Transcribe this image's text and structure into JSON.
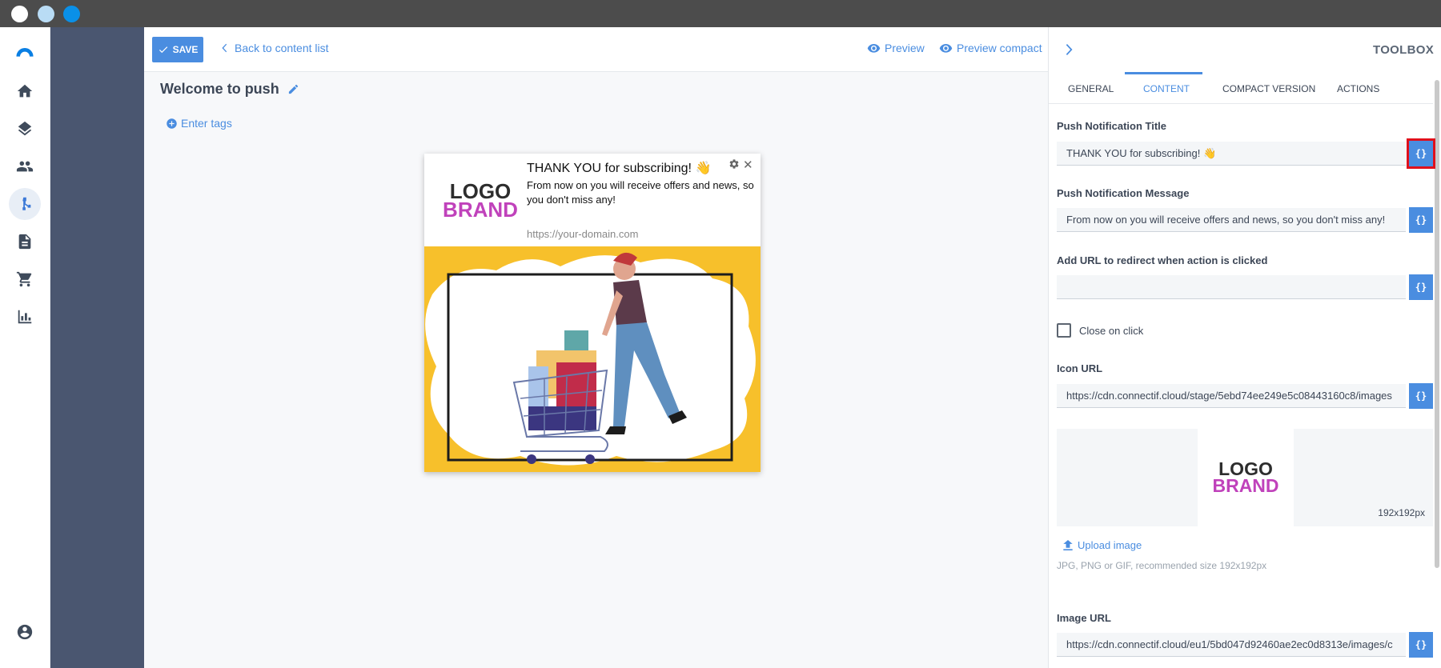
{
  "window": {
    "controls": [
      "close",
      "minimize",
      "maximize"
    ]
  },
  "nav": {
    "items": [
      {
        "icon": "logo-icon"
      },
      {
        "icon": "home-icon"
      },
      {
        "icon": "layers-icon"
      },
      {
        "icon": "people-icon"
      },
      {
        "icon": "workflow-icon",
        "active": true
      },
      {
        "icon": "document-icon"
      },
      {
        "icon": "cart-icon"
      },
      {
        "icon": "bar-chart-icon"
      },
      {
        "icon": "account-icon"
      }
    ]
  },
  "toolbar": {
    "save_label": "SAVE",
    "back_label": "Back to content list",
    "preview_label": "Preview",
    "preview_compact_label": "Preview compact"
  },
  "content": {
    "title": "Welcome to push",
    "tags_label": "Enter tags"
  },
  "push_preview": {
    "logo_line1": "LOGO",
    "logo_line2": "BRAND",
    "title": "THANK YOU for subscribing! 👋",
    "message": "From now on you will receive offers and news, so you don't miss any!",
    "domain": "https://your-domain.com",
    "close_glyph": "✕"
  },
  "toolbox": {
    "title": "TOOLBOX",
    "tabs": [
      "GENERAL",
      "CONTENT",
      "COMPACT VERSION",
      "ACTIONS"
    ],
    "active_tab": "CONTENT",
    "var_button_label": "{}",
    "fields": {
      "push_title": {
        "label": "Push Notification Title",
        "value": "THANK YOU for subscribing! 👋"
      },
      "push_message": {
        "label": "Push Notification Message",
        "value": "From now on you will receive offers and news, so you don't miss any!"
      },
      "redirect_url": {
        "label": "Add URL to redirect when action is clicked",
        "value": ""
      },
      "close_on_click": {
        "label": "Close on click",
        "checked": false
      },
      "icon_url": {
        "label": "Icon URL",
        "value": "https://cdn.connectif.cloud/stage/5ebd74ee249e5c08443160c8/images"
      },
      "image_url": {
        "label": "Image URL",
        "value": "https://cdn.connectif.cloud/eu1/5bd047d92460ae2ec0d8313e/images/c"
      }
    },
    "icon_preview": {
      "logo_line1": "LOGO",
      "logo_line2": "BRAND",
      "size_label": "192x192px"
    },
    "upload_label": "Upload image",
    "upload_hint": "JPG, PNG or GIF, recommended size 192x192px"
  },
  "colors": {
    "accent": "#4a8de0",
    "rail": "#4a5670",
    "titlebar": "#4c4c4c",
    "brand_pink": "#c042bb",
    "illustration_yellow": "#f7c02b",
    "highlight_red": "#e0101c"
  }
}
